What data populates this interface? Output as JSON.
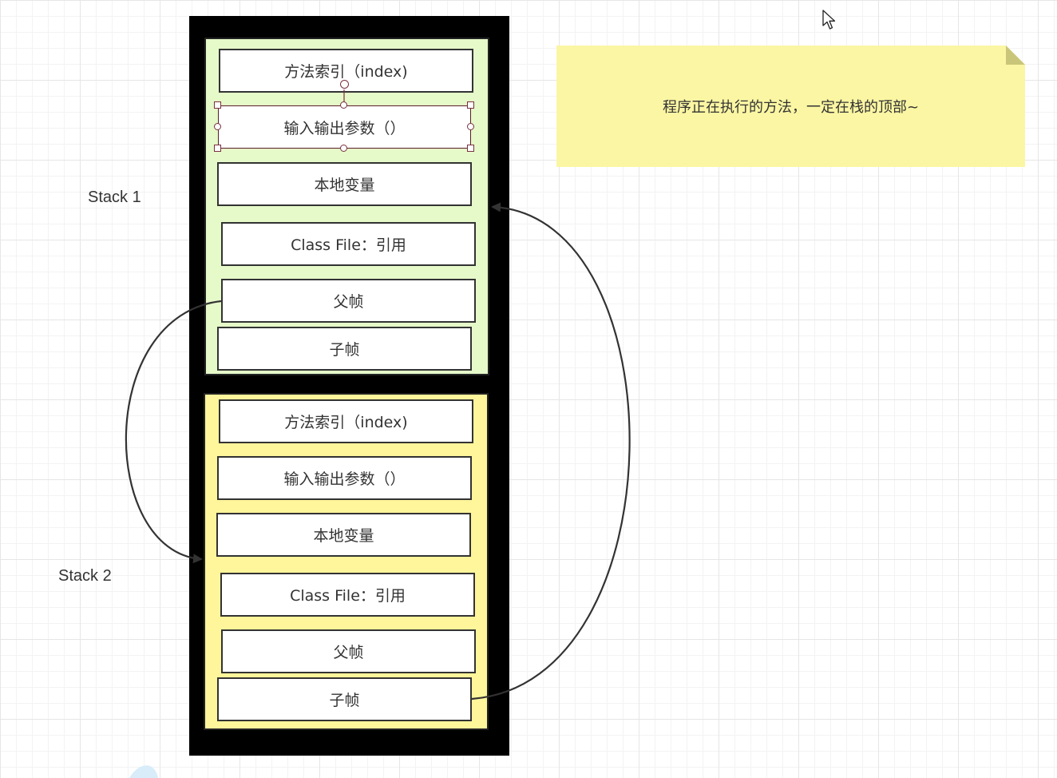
{
  "colors": {
    "stack_border": "#000000",
    "frame1_fill": "#e6f9c9",
    "frame2_fill": "#fff59a",
    "note_fill": "#fbf6a3",
    "connector": "#333333",
    "selection": "#7a3040"
  },
  "labels": {
    "stack1": "Stack 1",
    "stack2": "Stack 2"
  },
  "note": {
    "text": "程序正在执行的方法，一定在栈的顶部~"
  },
  "frame1": {
    "cells": {
      "method_index": "方法索引（index)",
      "io_params": "输入输出参数（）",
      "local_vars": "本地变量",
      "class_file": "Class File：引用",
      "parent_frame": "父帧",
      "child_frame": "子帧"
    }
  },
  "frame2": {
    "cells": {
      "method_index": "方法索引（index)",
      "io_params": "输入输出参数（）",
      "local_vars": "本地变量",
      "class_file": "Class File：引用",
      "parent_frame": "父帧",
      "child_frame": "子帧"
    }
  },
  "icons": {
    "cursor": "mouse-pointer-icon"
  }
}
